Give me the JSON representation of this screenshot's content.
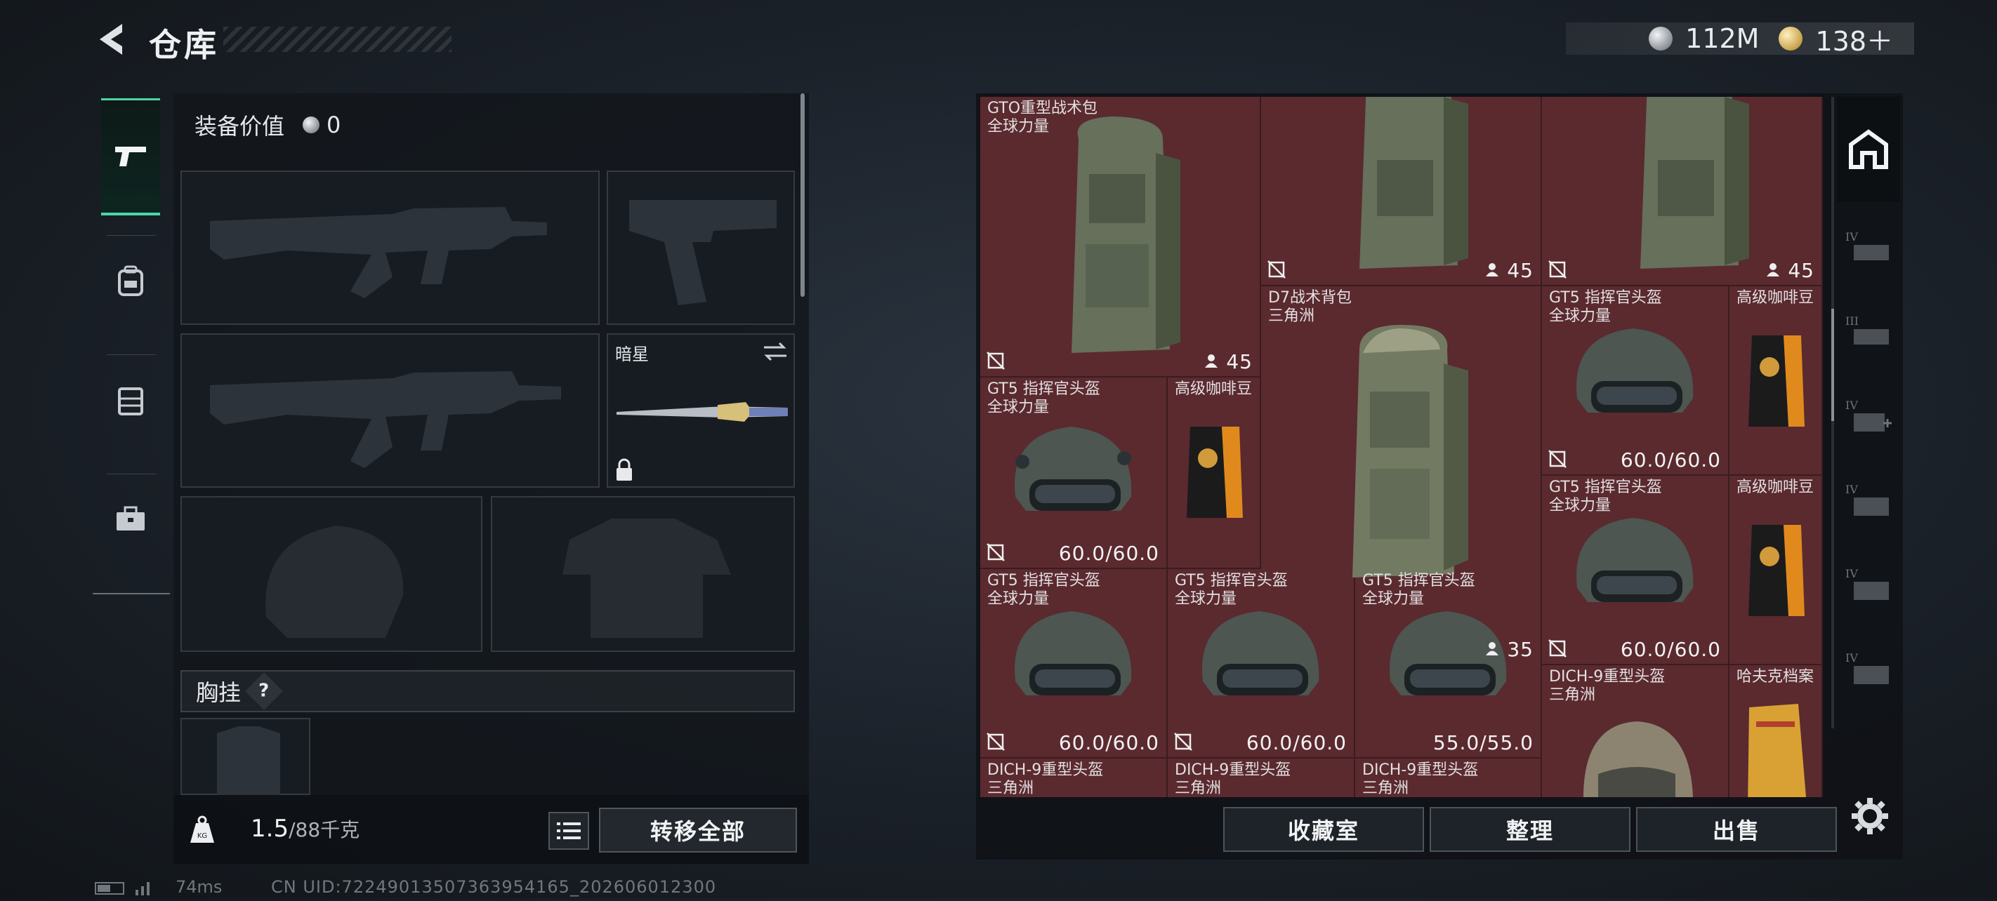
{
  "header": {
    "title": "仓库"
  },
  "currency": {
    "silver": "112M",
    "gold": "138＋"
  },
  "equipment": {
    "value_label": "装备价值",
    "value": "0",
    "knife_name": "暗星",
    "chest_label": "胸挂",
    "chest_help": "?"
  },
  "footer_left": {
    "weight_current": "1.5",
    "weight_max": "/88千克",
    "transfer_all": "转移全部"
  },
  "grid_items": [
    {
      "name": "GTO重型战术包",
      "sub": "全球力量",
      "value": "45"
    },
    {
      "name": "",
      "sub": "",
      "value": "45"
    },
    {
      "name": "",
      "sub": "",
      "value": "45"
    },
    {
      "name": "D7战术背包",
      "sub": "三角洲",
      "value": "35"
    },
    {
      "name": "GT5 指挥官头盔",
      "sub": "全球力量",
      "value": "60.0/60.0"
    },
    {
      "name": "高级咖啡豆",
      "sub": "",
      "value": ""
    },
    {
      "name": "GT5 指挥官头盔",
      "sub": "全球力量",
      "value": "60.0/60.0"
    },
    {
      "name": "高级咖啡豆",
      "sub": "",
      "value": ""
    },
    {
      "name": "GT5 指挥官头盔",
      "sub": "全球力量",
      "value": "60.0/60.0"
    },
    {
      "name": "高级咖啡豆",
      "sub": "",
      "value": ""
    },
    {
      "name": "GT5 指挥官头盔",
      "sub": "全球力量",
      "value": "60.0/60.0"
    },
    {
      "name": "GT5 指挥官头盔",
      "sub": "全球力量",
      "value": "60.0/60.0"
    },
    {
      "name": "GT5 指挥官头盔",
      "sub": "全球力量",
      "value": "55.0/55.0"
    },
    {
      "name": "DICH-9重型头盔",
      "sub": "三角洲",
      "value": ""
    },
    {
      "name": "哈夫克档案",
      "sub": "",
      "value": ""
    },
    {
      "name": "DICH-9重型头盔",
      "sub": "三角洲",
      "value": ""
    },
    {
      "name": "DICH-9重型头盔",
      "sub": "三角洲",
      "value": ""
    },
    {
      "name": "DICH-9重型头盔",
      "sub": "三角洲",
      "value": ""
    }
  ],
  "right_buttons": {
    "collection": "收藏室",
    "organize": "整理",
    "sell": "出售"
  },
  "category_tabs": [
    "IV",
    "III",
    "IV",
    "IV",
    "IV",
    "IV"
  ],
  "status": {
    "latency": "74ms",
    "uid": "CN UID:7224901350736395416​5_202606012300"
  },
  "icons": [
    "back-arrow-icon",
    "silver-coin-icon",
    "gold-coin-icon",
    "pistol-icon",
    "backpack-icon",
    "vest-icon",
    "toolbox-icon",
    "weight-icon",
    "list-icon",
    "stash-icon",
    "settings-icon",
    "lock-icon",
    "swap-icon",
    "no-bind-icon",
    "owner-icon"
  ],
  "colors": {
    "accent": "#4bd5a8",
    "grid_bg": "#5a2a2f"
  }
}
